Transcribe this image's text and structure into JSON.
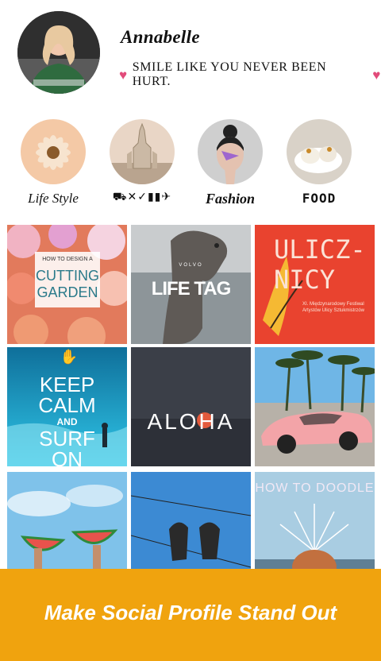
{
  "profile": {
    "name": "Annabelle",
    "bio": "SMILE LIKE YOU NEVER BEEN HURT.",
    "heart_color": "#e24b7a"
  },
  "highlights": [
    {
      "label": "Life Style"
    },
    {
      "label": "⛟✕✓▮▮✈"
    },
    {
      "label": "Fashion"
    },
    {
      "label": "FOOD"
    }
  ],
  "grid": {
    "tile1": {
      "line1": "HOW TO DESIGN A",
      "line2": "CUTTING",
      "line3": "GARDEN"
    },
    "tile2": {
      "small": "VOLVO",
      "big": "LIFE TAG"
    },
    "tile3": {
      "line1": "ULICZ-",
      "line2": "NICY",
      "small": "XI. Międzynarodowy Festiwal Artystów Ulicy Sztukmistrzów"
    },
    "tile4": {
      "line1": "KEEP",
      "line2": "CALM",
      "line3": "AND",
      "line4": "SURF",
      "line5": "ON"
    },
    "tile5": {
      "text": "ALOHA"
    },
    "tile9": {
      "text": "HOW TO DOODLE"
    }
  },
  "banner": {
    "text": "Make Social Profile Stand Out",
    "color": "#f0a30e"
  }
}
